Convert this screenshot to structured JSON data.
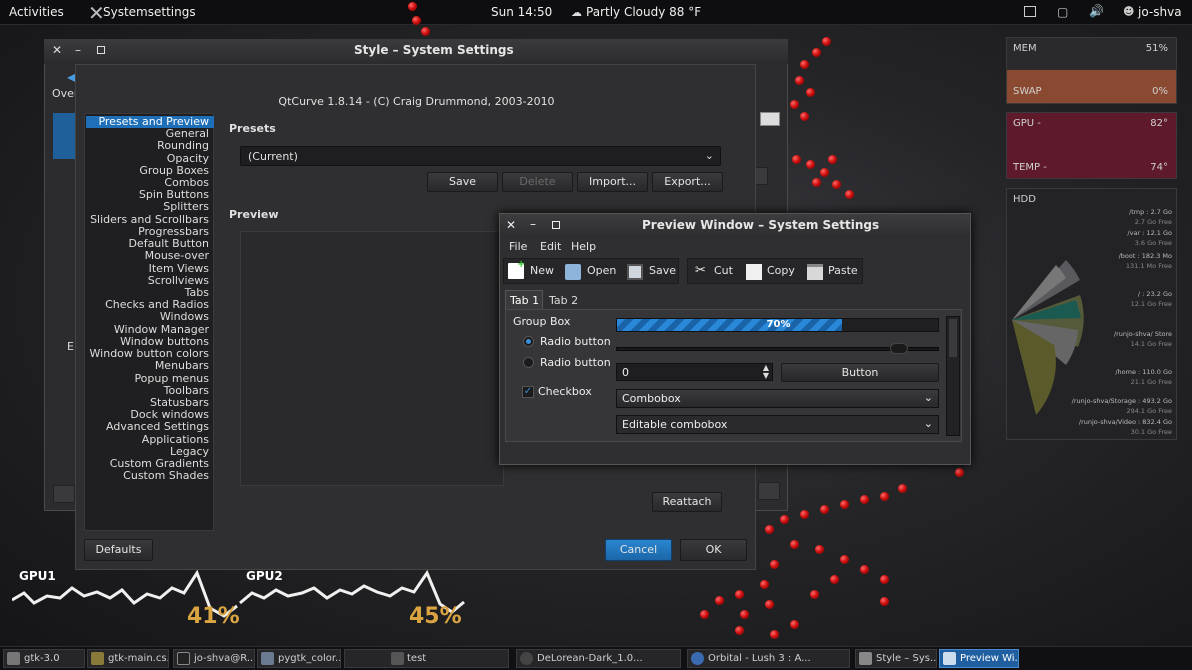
{
  "topbar": {
    "activities": "Activities",
    "app_name": "Systemsettings",
    "clock": "Sun 14:50",
    "weather": "Partly Cloudy 88 °F",
    "user": "jo-shva"
  },
  "conky": {
    "mem_label": "MEM",
    "mem_val": "51%",
    "swap_label": "SWAP",
    "swap_val": "0%",
    "gpu_label": "GPU -",
    "gpu_val": "82°",
    "temp_label": "TEMP -",
    "temp_val": "74°",
    "hdd_label": "HDD",
    "hdd": [
      {
        "mount": "/tmp : 2.7 Go",
        "free": "2.7 Go Free"
      },
      {
        "mount": "/var : 12.1 Go",
        "free": "3.6 Go Free"
      },
      {
        "mount": "/boot : 182.3 Mo",
        "free": "131.1 Mo Free"
      },
      {
        "mount": "/ : 23.2 Go",
        "free": "12.1 Go Free"
      },
      {
        "mount": "/runjo-shva/ Store",
        "free": "14.1 Go Free"
      },
      {
        "mount": "/home : 110.0 Go",
        "free": "21.1 Go Free"
      },
      {
        "mount": "/runjo-shva/Storage : 493.2 Go",
        "free": "294.1 Go Free"
      },
      {
        "mount": "/runjo-shva/Video : 832.4 Go",
        "free": "30.1 Go Free"
      }
    ],
    "gpu1_label": "GPU1",
    "gpu1_val": "41%",
    "gpu2_label": "GPU2",
    "gpu2_val": "45%"
  },
  "main_window": {
    "title": "Style – System Settings",
    "behind_label_1": "Over",
    "behind_label_2": "E",
    "header": "QtCurve 1.8.14 - (C) Craig Drummond, 2003-2010",
    "sidebar": [
      "Presets and Preview",
      "General",
      "Rounding",
      "Opacity",
      "Group Boxes",
      "Combos",
      "Spin Buttons",
      "Splitters",
      "Sliders and Scrollbars",
      "Progressbars",
      "Default Button",
      "Mouse-over",
      "Item Views",
      "Scrollviews",
      "Tabs",
      "Checks and Radios",
      "Windows",
      "Window Manager",
      "Window buttons",
      "Window button colors",
      "Menubars",
      "Popup menus",
      "Toolbars",
      "Statusbars",
      "Dock windows",
      "Advanced Settings",
      "Applications",
      "Legacy",
      "Custom Gradients",
      "Custom Shades"
    ],
    "presets_label": "Presets",
    "preset_value": "(Current)",
    "save": "Save",
    "delete": "Delete",
    "import": "Import...",
    "export": "Export...",
    "preview_label": "Preview",
    "reattach": "Reattach",
    "defaults": "Defaults",
    "cancel": "Cancel",
    "ok": "OK"
  },
  "preview_window": {
    "title": "Preview Window – System Settings",
    "menu": [
      "File",
      "Edit",
      "Help"
    ],
    "toolbar": [
      "New",
      "Open",
      "Save",
      "Cut",
      "Copy",
      "Paste"
    ],
    "tabs": [
      "Tab 1",
      "Tab 2"
    ],
    "group_box": "Group Box",
    "progress_label": "70%",
    "progress": 0.7,
    "slider": 0.9,
    "radio1": "Radio button",
    "radio2": "Radio button",
    "checkbox": "Checkbox",
    "spin_value": "0",
    "button": "Button",
    "combobox": "Combobox",
    "editable_combobox": "Editable combobox"
  },
  "taskbar": [
    "gtk-3.0",
    "gtk-main.cs...",
    "jo-shva@R...",
    "pygtk_color...",
    "test",
    "DeLorean-Dark_1.0...",
    "Orbital - Lush 3  :  A...",
    "Style – Sys...",
    "Preview Wi..."
  ],
  "colors": {
    "accent": "#1f6fb8",
    "mem_bar": "#8a4a32",
    "gpu_bar": "#7a1f34",
    "gpu_pct": "#d9a441"
  }
}
